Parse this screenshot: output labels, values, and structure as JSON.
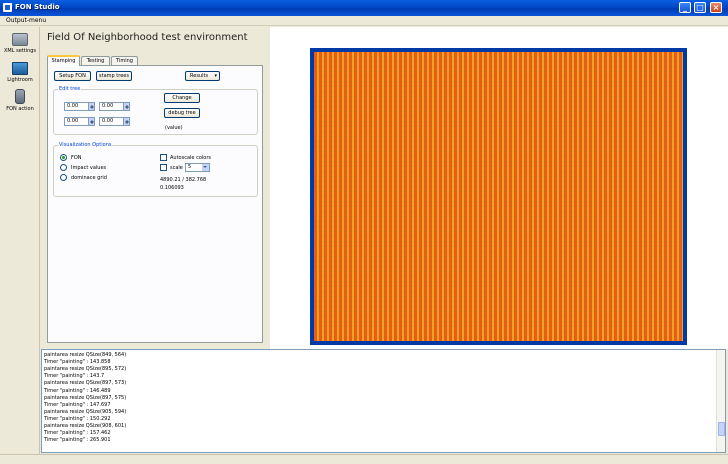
{
  "window": {
    "title": "FON Studio"
  },
  "menu": {
    "item": "Output-menu"
  },
  "left_toolbar": [
    {
      "label": "XML settings",
      "icon": "xml-settings-icon"
    },
    {
      "label": "Lightroom",
      "icon": "lightroom-icon"
    },
    {
      "label": "FON action",
      "icon": "fon-action-icon"
    }
  ],
  "page": {
    "title": "Field Of Neighborhood test environment"
  },
  "tabs": [
    {
      "label": "Stamping",
      "active": true
    },
    {
      "label": "Testing",
      "active": false
    },
    {
      "label": "Timing",
      "active": false
    }
  ],
  "toolbar": {
    "setup_fon": "Setup FON",
    "stamp_trees": "stamp trees",
    "results": "Results"
  },
  "edit_tree": {
    "title": "Edit tree",
    "values": [
      "0.00",
      "0.00",
      "0.00",
      "0.00"
    ],
    "change": "Change",
    "debug": "debug tree",
    "value_label": "(value)"
  },
  "viz": {
    "title": "Visualization Options",
    "radios": [
      {
        "label": "FON",
        "checked": true
      },
      {
        "label": "Impact values",
        "checked": false
      },
      {
        "label": "dominace grid",
        "checked": false
      }
    ],
    "autoscale": "Autoscale colors",
    "scale": "scale",
    "scale_value": "5",
    "readout1": "4890.21 / 382.768",
    "readout2": "0.106093"
  },
  "canvas_colors": {
    "border": "#003aa6",
    "base": "#f05a12",
    "stripe": "#e4bc2c"
  },
  "console_lines": [
    "paintarea resize QSize(849, 564)",
    "Timer \"painting\" :  143.858",
    "paintarea resize QSize(895, 572)",
    "Timer \"painting\" :  143.7",
    "paintarea resize QSize(897, 573)",
    "Timer \"painting\" :  146.489",
    "paintarea resize QSize(897, 575)",
    "Timer \"painting\" :  147.697",
    "paintarea resize QSize(905, 594)",
    "Timer \"painting\" :  150.292",
    "paintarea resize QSize(908, 601)",
    "Timer \"painting\" :  157.462",
    "Timer \"painting\" :  265.901"
  ]
}
